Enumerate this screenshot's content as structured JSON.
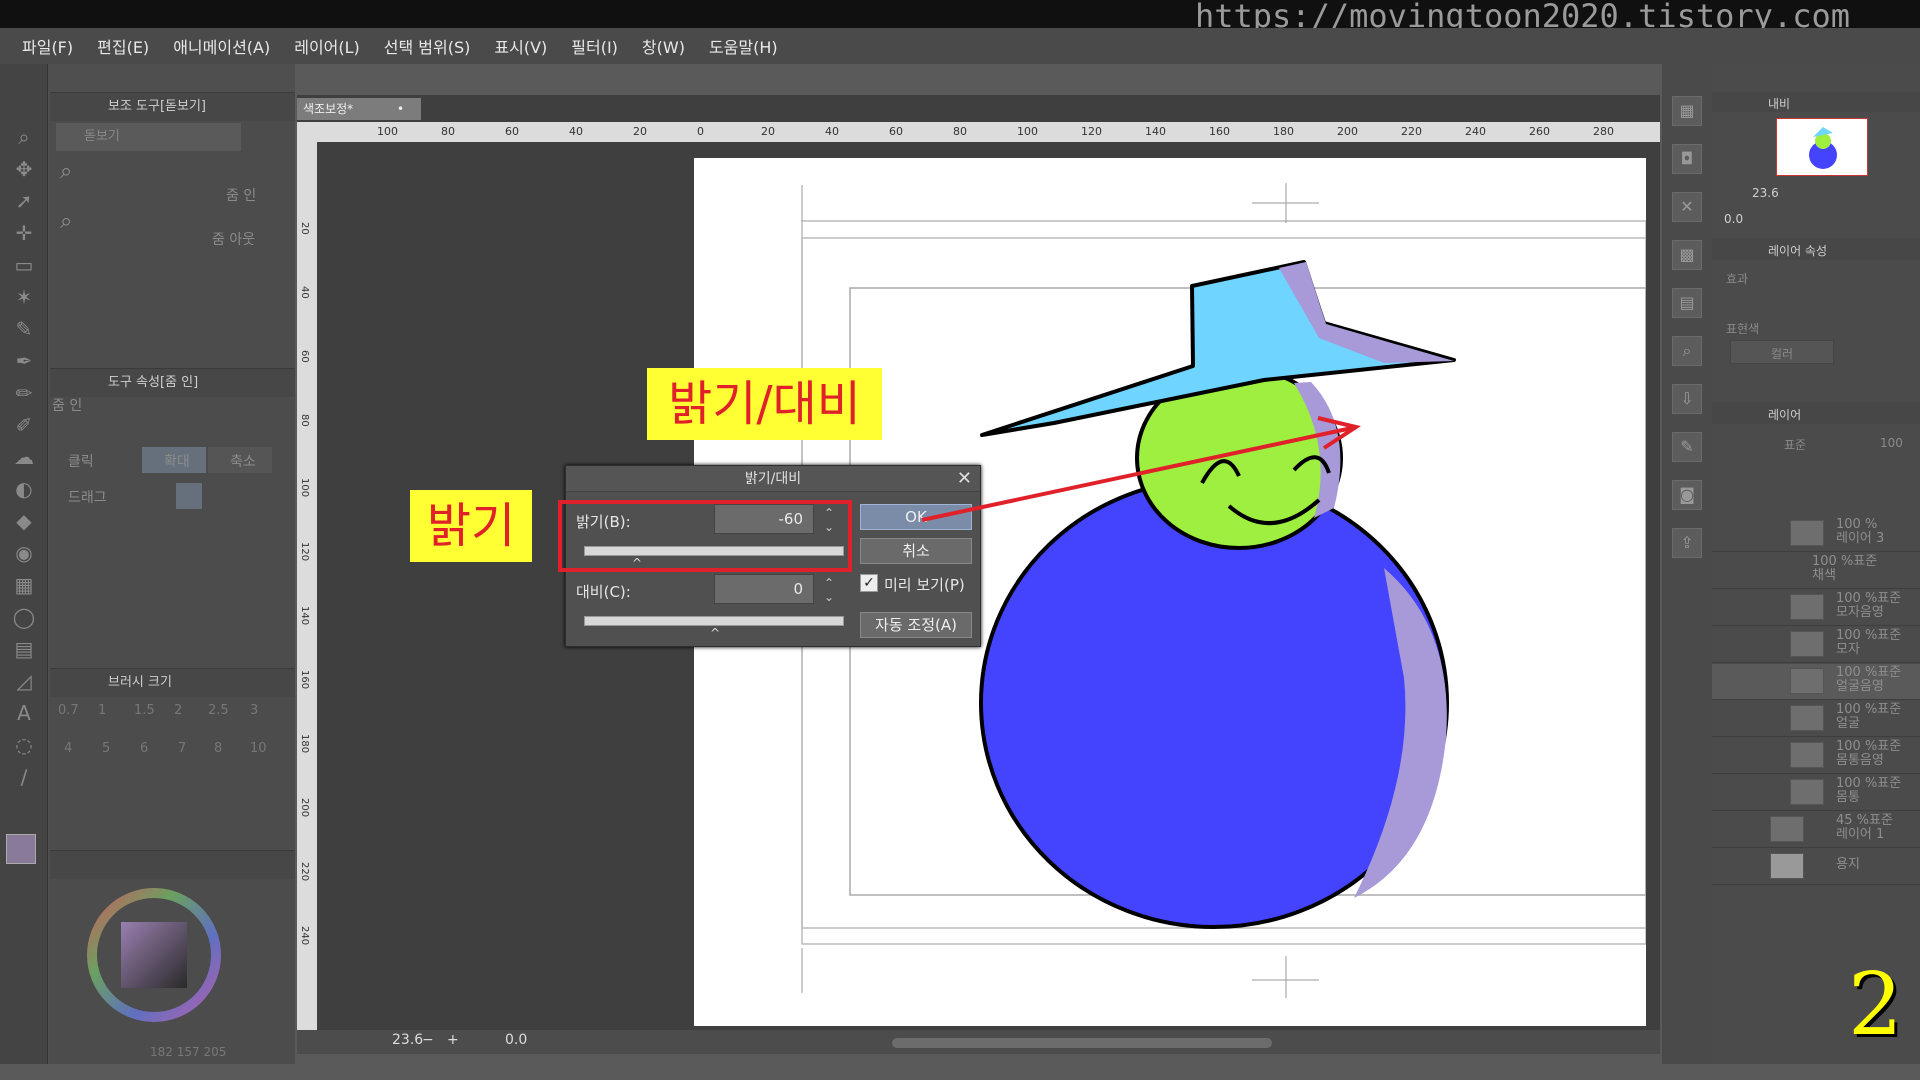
{
  "watermark": "https://movingtoon2020.tistory.com",
  "menu": [
    "파일(F)",
    "편집(E)",
    "애니메이션(A)",
    "레이어(L)",
    "선택 범위(S)",
    "표시(V)",
    "필터(I)",
    "창(W)",
    "도움말(H)"
  ],
  "left": {
    "sub_tool_title": "보조 도구[돋보기]",
    "sub_tool_item": "돋보기",
    "zoom_in": "줌 인",
    "zoom_out": "줌 아웃",
    "tool_prop_title": "도구 속성[줌 인]",
    "tool_prop_sub": "줌 인",
    "click_label": "클릭",
    "enlarge": "확대",
    "shrink": "축소",
    "drag_label": "드래그",
    "brush_size_title": "브러시 크기",
    "brush_sizes": [
      "0.7",
      "1",
      "1.5",
      "2",
      "2.5",
      "3",
      "4",
      "5",
      "6",
      "7",
      "8",
      "10"
    ],
    "color_values": [
      "182",
      "157",
      "205"
    ]
  },
  "canvas": {
    "tab": "색조보정*",
    "zoom": "23.6",
    "angle": "0.0",
    "ruler_top": [
      "100",
      "80",
      "60",
      "40",
      "20",
      "0",
      "20",
      "40",
      "60",
      "80",
      "100",
      "120",
      "140",
      "160",
      "180",
      "200",
      "220",
      "240",
      "260",
      "280"
    ],
    "ruler_left": [
      "20",
      "40",
      "60",
      "80",
      "100",
      "120",
      "140",
      "160",
      "180",
      "200",
      "220",
      "240"
    ]
  },
  "dialog": {
    "title": "밝기/대비",
    "brightness_label": "밝기(B):",
    "brightness_value": "-60",
    "contrast_label": "대비(C):",
    "contrast_value": "0",
    "brightness_level": -60,
    "contrast_level": 0,
    "ok": "OK",
    "cancel": "취소",
    "preview": "미리 보기(P)",
    "preview_checked": true,
    "auto": "자동 조정(A)"
  },
  "annotations": {
    "title_label": "밝기/대비",
    "brightness_label": "밝기",
    "page_number": "2",
    "accent": "#e0212a",
    "highlight": "#ffff33"
  },
  "right": {
    "navigator": "내비",
    "nav_zoom": "23.6",
    "nav_angle": "0.0",
    "layer_props": "레이어 속성",
    "effect": "효과",
    "expr_color": "표현색",
    "color_mode": "컬러",
    "layers_title": "레이어",
    "blend": "표준",
    "opacity": "100",
    "layers": [
      {
        "pct": "100 %",
        "name": "레이어 3"
      },
      {
        "pct": "100 %표준",
        "name": "채색"
      },
      {
        "pct": "100 %표준",
        "name": "모자음영"
      },
      {
        "pct": "100 %표준",
        "name": "모자"
      },
      {
        "pct": "100 %표준",
        "name": "얼굴음영"
      },
      {
        "pct": "100 %표준",
        "name": "얼굴"
      },
      {
        "pct": "100 %표준",
        "name": "몸통음영"
      },
      {
        "pct": "100 %표준",
        "name": "몸통"
      },
      {
        "pct": "45 %표준",
        "name": "레이어 1"
      },
      {
        "pct": "",
        "name": "용지"
      }
    ]
  }
}
